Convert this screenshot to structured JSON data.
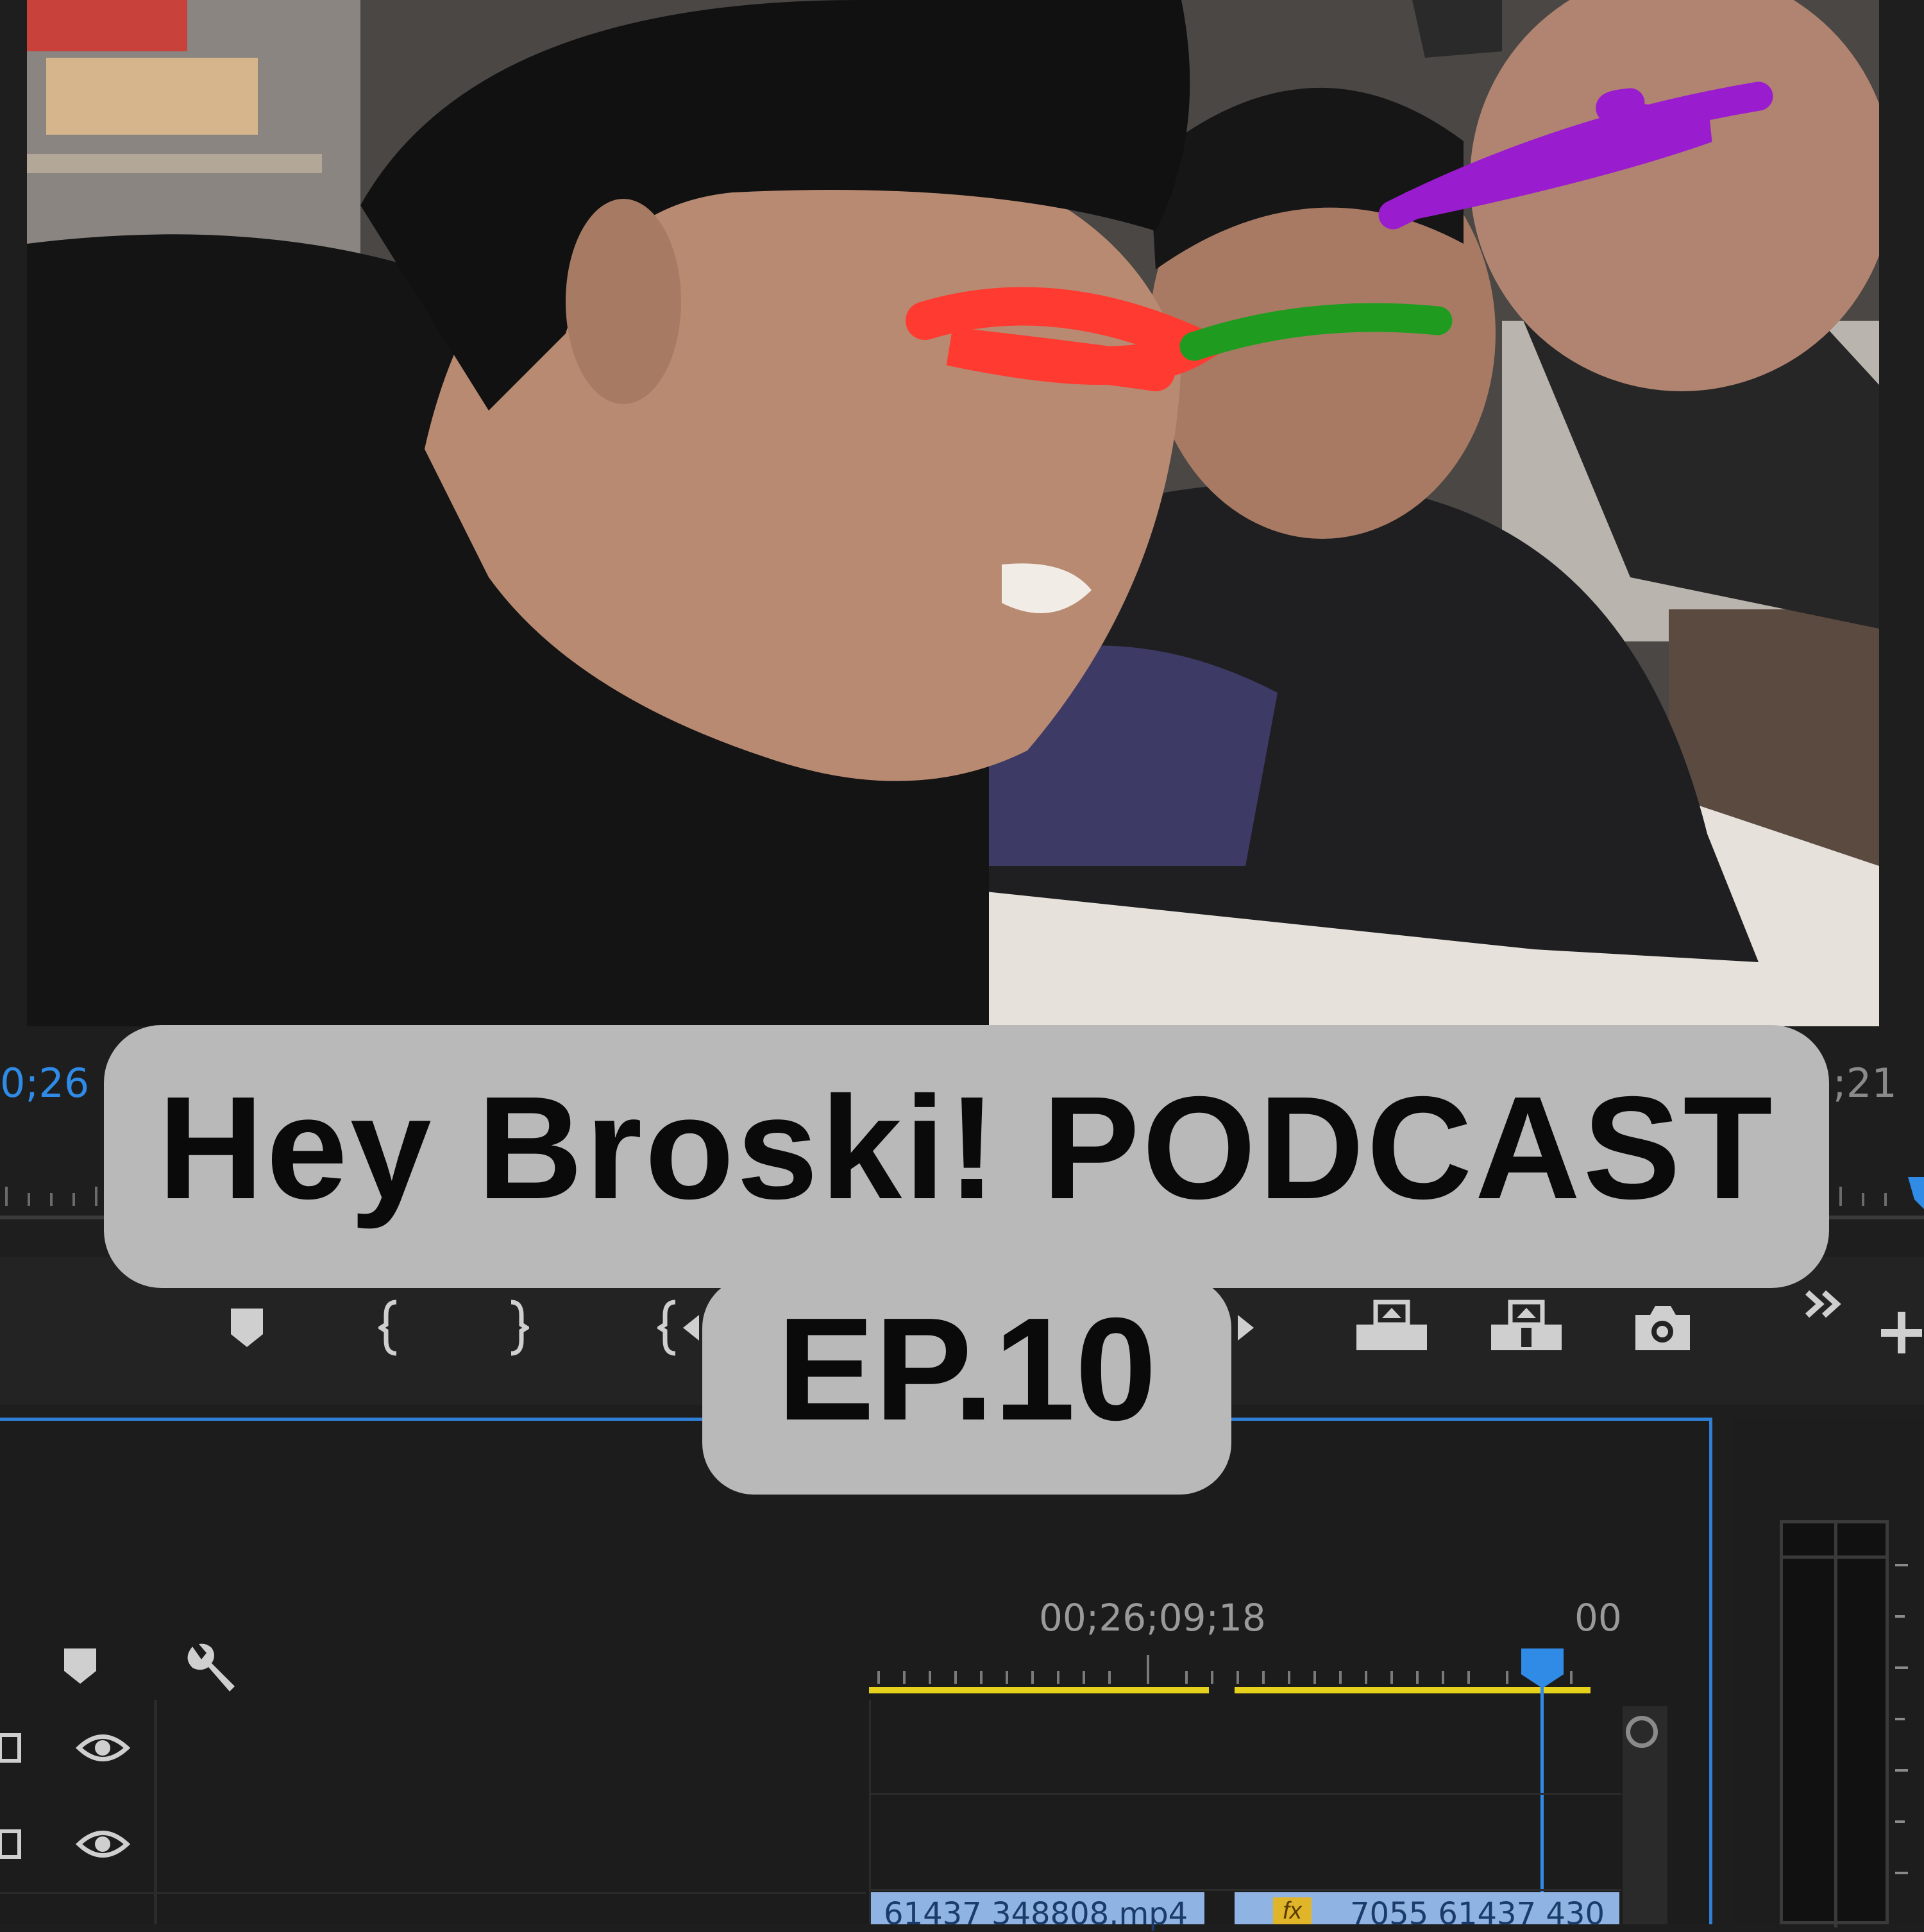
{
  "overlay": {
    "title_line1": "Hey Broski! PODCAST",
    "title_line2": "EP.10"
  },
  "monitor": {
    "timecode_left": "0;26",
    "timecode_right": ";21"
  },
  "timeline": {
    "playhead_timecode": "00;26;09;18",
    "end_timecode": "00",
    "clip_1_name": "61437 348808.mp4",
    "clip_2_name": "7055 61437 430",
    "clip_2_fx": "fx"
  },
  "icons": [
    "marker-icon",
    "mark-in-icon",
    "mark-out-icon",
    "go-to-in-icon",
    "lift-icon",
    "extract-icon",
    "export-frame-icon",
    "more-icon",
    "add-icon",
    "wrench-icon",
    "eye-icon",
    "snap-icon"
  ],
  "colors": {
    "accent_blue": "#2f8be6",
    "work_area_yellow": "#e6d21c",
    "clip_blue": "#8fb4e3",
    "overlay_grey": "#b9b9b9",
    "scribble_red": "#ff3a30",
    "scribble_green": "#1f9c1f",
    "scribble_purple": "#9a1ccf"
  }
}
